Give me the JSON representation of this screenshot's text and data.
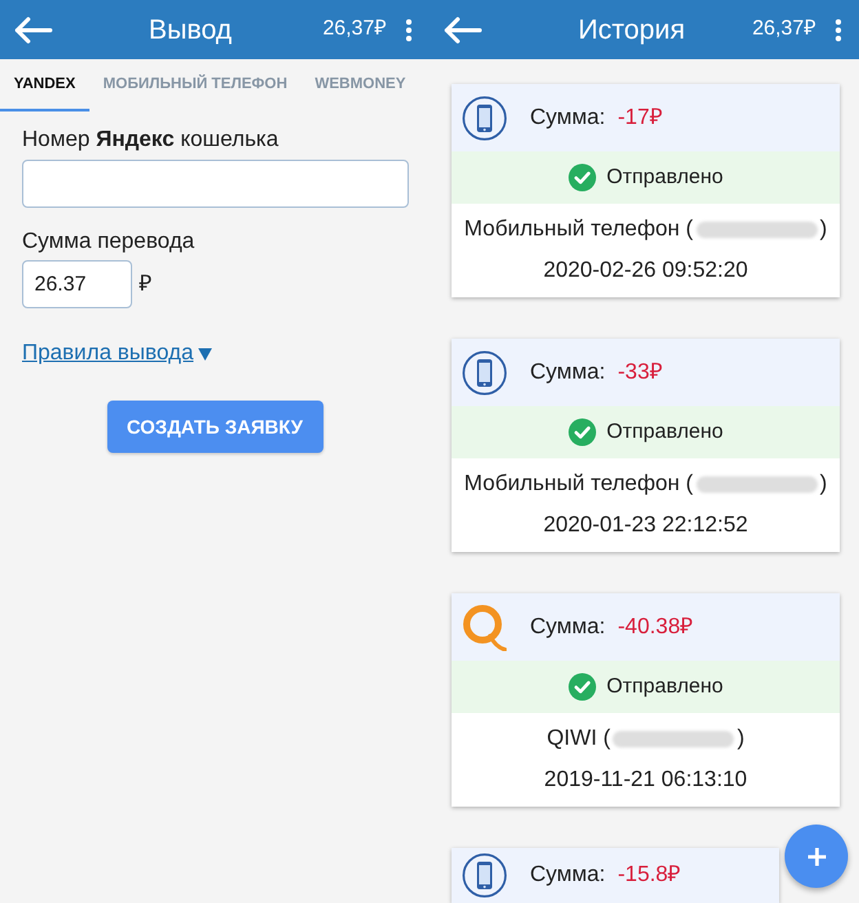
{
  "withdraw_screen": {
    "title": "Вывод",
    "balance": "26,37₽",
    "tabs": [
      {
        "label": "YANDEX",
        "selected": true
      },
      {
        "label": "МОБИЛЬНЫЙ ТЕЛЕФОН",
        "selected": false
      },
      {
        "label": "WEBMONEY",
        "selected": false
      }
    ],
    "wallet_field": {
      "label": "Номер **Яндекс** кошелька"
    },
    "amount_field": {
      "label": "Сумма перевода",
      "value": "26.37",
      "currency": "₽"
    },
    "rules_link": "Правила вывода",
    "submit_button": "СОЗДАТЬ ЗАЯВКУ"
  },
  "history_screen": {
    "title": "История",
    "balance": "26,37₽",
    "transactions": [
      {
        "kind": "phone",
        "amount_label": "Сумма:",
        "amount": "-17₽",
        "status": "Отправлено",
        "sent": true,
        "account_before": "Мобильный телефон (",
        "account_after": ")",
        "datetime": "2020-02-26 09:52:20"
      },
      {
        "kind": "phone",
        "amount_label": "Сумма:",
        "amount": "-33₽",
        "status": "Отправлено",
        "sent": true,
        "account_before": "Мобильный телефон (",
        "account_after": ")",
        "datetime": "2020-01-23 22:12:52"
      },
      {
        "kind": "qiwi",
        "amount_label": "Сумма:",
        "amount": "-40.38₽",
        "status": "Отправлено",
        "sent": true,
        "account_before": "QIWI (",
        "account_after": ")",
        "datetime": "2019-11-21 06:13:10"
      },
      {
        "kind": "phone",
        "amount_label": "Сумма:",
        "amount": "-15.8₽"
      }
    ]
  }
}
